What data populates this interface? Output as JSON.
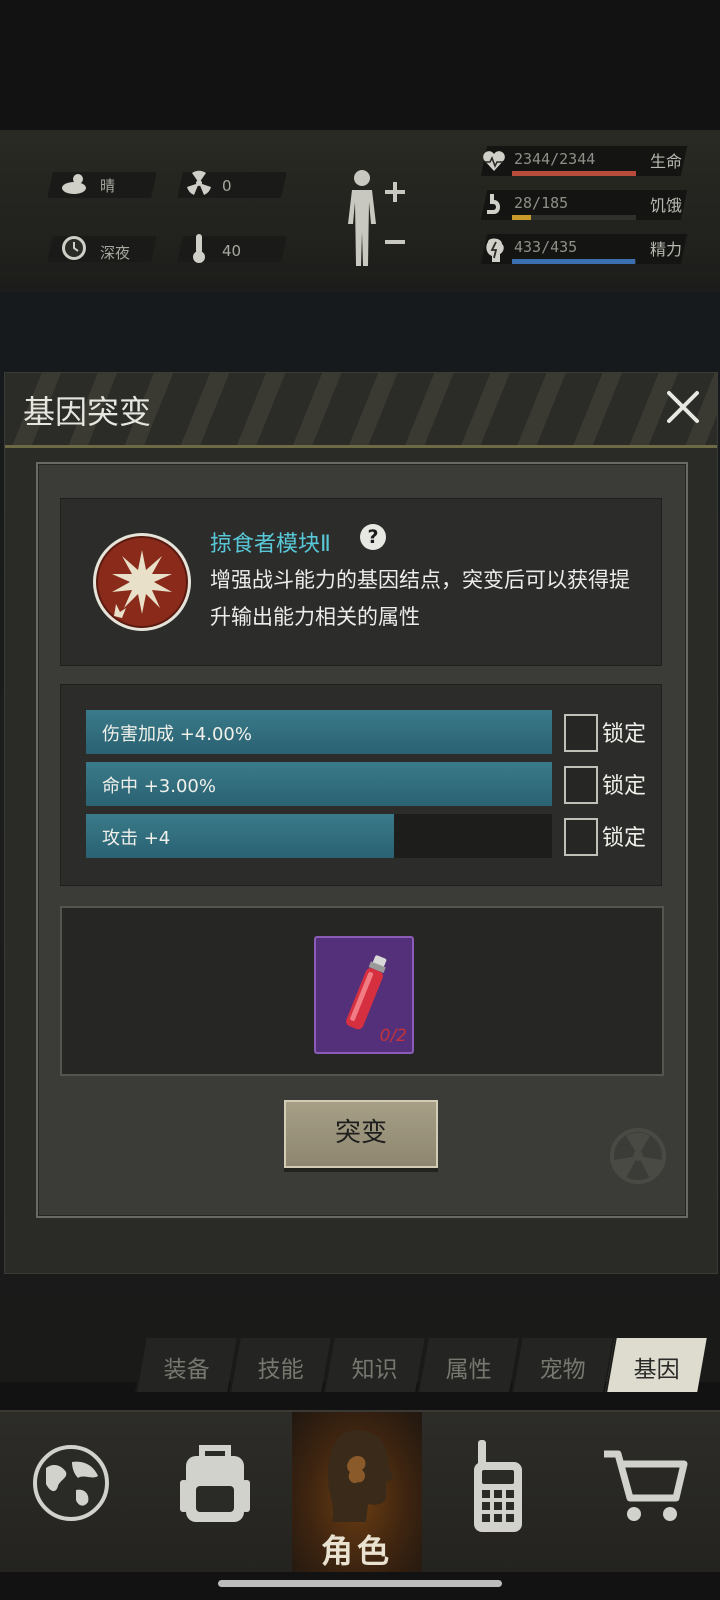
{
  "status": {
    "weather": "晴",
    "radiation": "0",
    "time_of_day": "深夜",
    "temperature": "40",
    "health": {
      "text": "2344/2344",
      "label": "生命",
      "fraction": 1.0,
      "color": "#b94b3a"
    },
    "hunger": {
      "text": "28/185",
      "label": "饥饿",
      "fraction": 0.15,
      "color": "#c79a2a"
    },
    "energy": {
      "text": "433/435",
      "label": "精力",
      "fraction": 0.995,
      "color": "#3a6fb0"
    }
  },
  "dialog": {
    "title": "基因突变",
    "module": {
      "name": "掠食者模块Ⅱ",
      "description": "增强战斗能力的基因结点，突变后可以获得提升输出能力相关的属性"
    },
    "attributes": [
      {
        "text": "伤害加成 +4.00%",
        "fill": 1.0,
        "lock_label": "锁定"
      },
      {
        "text": "命中 +3.00%",
        "fill": 1.0,
        "lock_label": "锁定"
      },
      {
        "text": "攻击 +4",
        "fill": 0.66,
        "lock_label": "锁定"
      }
    ],
    "item": {
      "count": "0/2",
      "icon": "red-vial-icon"
    },
    "mutate_button": "突变"
  },
  "tabs": [
    {
      "label": "装备",
      "active": false
    },
    {
      "label": "技能",
      "active": false
    },
    {
      "label": "知识",
      "active": false
    },
    {
      "label": "属性",
      "active": false
    },
    {
      "label": "宠物",
      "active": false
    },
    {
      "label": "基因",
      "active": true
    }
  ],
  "nav": {
    "role_label": "角色"
  }
}
